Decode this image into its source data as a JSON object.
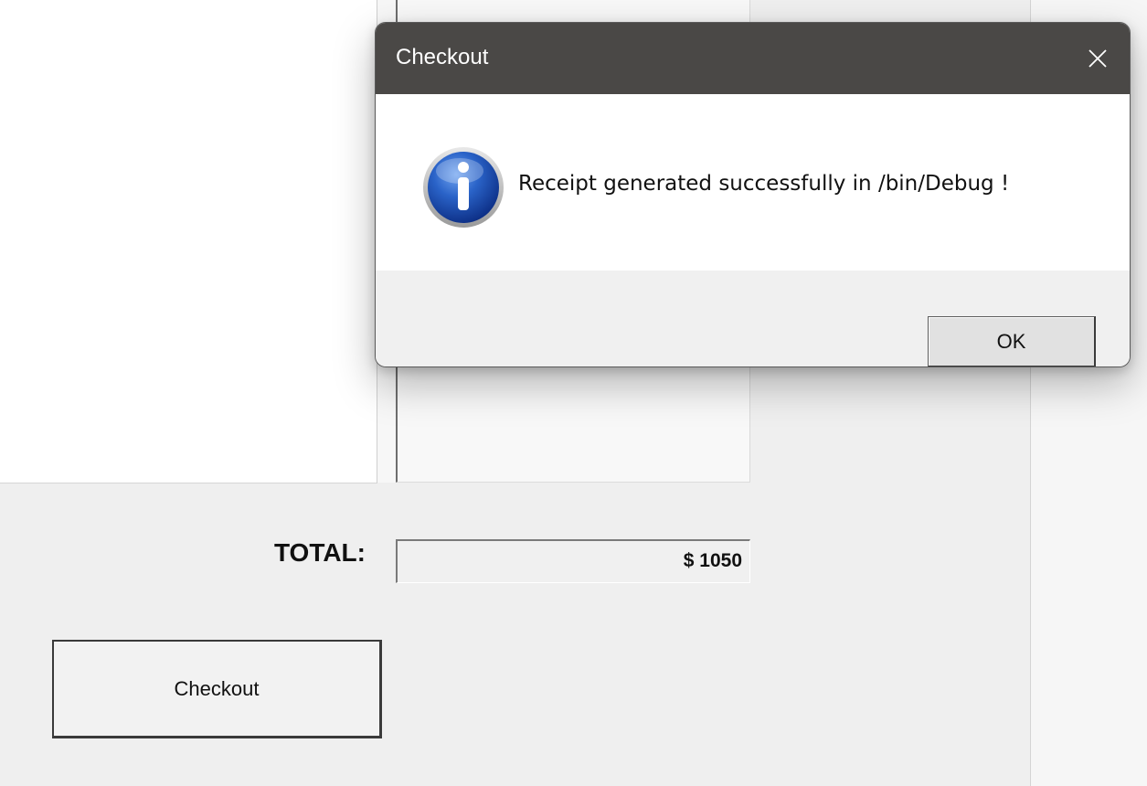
{
  "form": {
    "total_label": "TOTAL:",
    "total_value": "$ 1050",
    "checkout_button_label": "Checkout"
  },
  "dialog": {
    "title": "Checkout",
    "message": "Receipt generated successfully in /bin/Debug !",
    "icon": "info-icon",
    "close_icon": "close-icon",
    "ok_label": "OK"
  },
  "colors": {
    "titlebar": "#4a4846",
    "dialog_body": "#ffffff",
    "form_background": "#efefef",
    "info_icon_blue": "#1f53b5"
  }
}
